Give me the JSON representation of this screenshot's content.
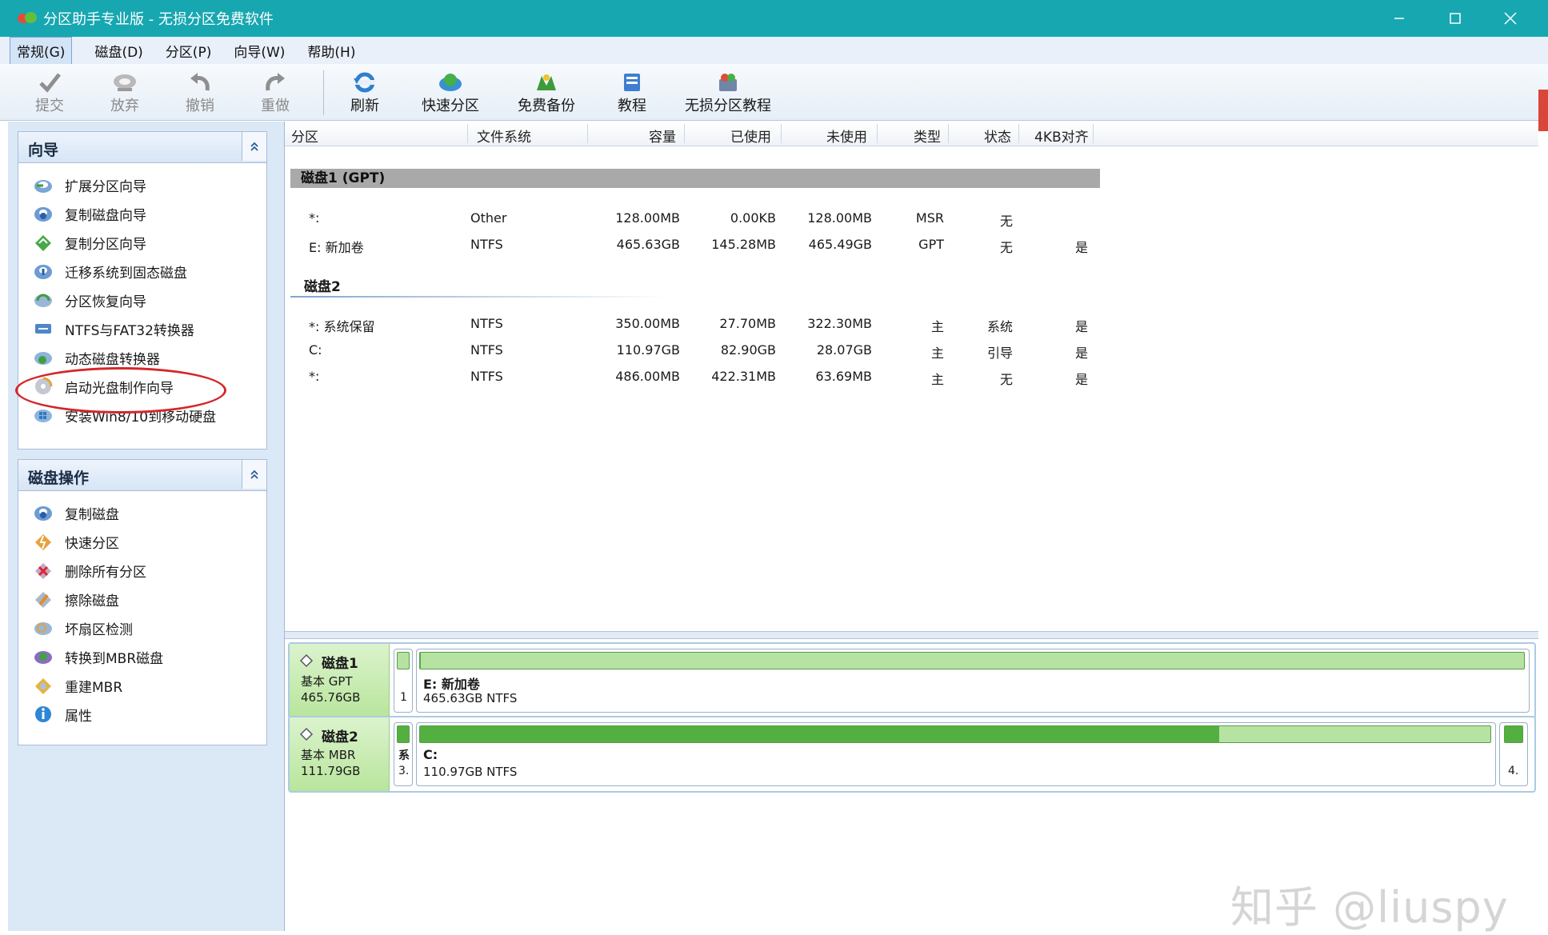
{
  "window": {
    "title": "分区助手专业版 - 无损分区免费软件",
    "controls": [
      "minimize",
      "maximize",
      "close"
    ]
  },
  "menu": [
    "常规(G)",
    "磁盘(D)",
    "分区(P)",
    "向导(W)",
    "帮助(H)"
  ],
  "toolbar": [
    {
      "label": "提交",
      "icon": "commit-check-icon",
      "enabled": false
    },
    {
      "label": "放弃",
      "icon": "discard-icon",
      "enabled": false
    },
    {
      "label": "撤销",
      "icon": "undo-icon",
      "enabled": false
    },
    {
      "label": "重做",
      "icon": "redo-icon",
      "enabled": false
    },
    {
      "label": "刷新",
      "icon": "refresh-icon",
      "enabled": true
    },
    {
      "label": "快速分区",
      "icon": "quick-partition-icon",
      "enabled": true
    },
    {
      "label": "免费备份",
      "icon": "free-backup-icon",
      "enabled": true
    },
    {
      "label": "教程",
      "icon": "tutorial-icon",
      "enabled": true
    },
    {
      "label": "无损分区教程",
      "icon": "lossless-tutorial-icon",
      "enabled": true
    }
  ],
  "wizard": {
    "title": "向导",
    "items": [
      "扩展分区向导",
      "复制磁盘向导",
      "复制分区向导",
      "迁移系统到固态磁盘",
      "分区恢复向导",
      "NTFS与FAT32转换器",
      "动态磁盘转换器",
      "启动光盘制作向导",
      "安装Win8/10到移动硬盘"
    ],
    "highlighted": "迁移系统到固态磁盘"
  },
  "disk_ops": {
    "title": "磁盘操作",
    "items": [
      "复制磁盘",
      "快速分区",
      "删除所有分区",
      "擦除磁盘",
      "坏扇区检测",
      "转换到MBR磁盘",
      "重建MBR",
      "属性"
    ]
  },
  "table": {
    "columns": [
      "分区",
      "文件系统",
      "容量",
      "已使用",
      "未使用",
      "类型",
      "状态",
      "4KB对齐"
    ],
    "disks": [
      {
        "name": "磁盘1 (GPT)",
        "rows": [
          [
            "*:",
            "Other",
            "128.00MB",
            "0.00KB",
            "128.00MB",
            "MSR",
            "无",
            ""
          ],
          [
            "E: 新加卷",
            "NTFS",
            "465.63GB",
            "145.28MB",
            "465.49GB",
            "GPT",
            "无",
            "是"
          ]
        ]
      },
      {
        "name": "磁盘2",
        "rows": [
          [
            "*: 系统保留",
            "NTFS",
            "350.00MB",
            "27.70MB",
            "322.30MB",
            "主",
            "系统",
            "是"
          ],
          [
            "C:",
            "NTFS",
            "110.97GB",
            "82.90GB",
            "28.07GB",
            "主",
            "引导",
            "是"
          ],
          [
            "*:",
            "NTFS",
            "486.00MB",
            "422.31MB",
            "63.69MB",
            "主",
            "无",
            "是"
          ]
        ]
      }
    ]
  },
  "diskmap": [
    {
      "name": "磁盘1",
      "type": "基本 GPT",
      "size": "465.76GB",
      "small_part": "1",
      "main_part": {
        "label": "E: 新加卷",
        "detail": "465.63GB NTFS",
        "used_fraction": 0.0003
      }
    },
    {
      "name": "磁盘2",
      "type": "基本 MBR",
      "size": "111.79GB",
      "small_part_a": "系",
      "small_part_b": "3.",
      "main_part": {
        "label": "C:",
        "detail": "110.97GB NTFS",
        "used_fraction": 0.747
      },
      "tail_part": "4."
    }
  ],
  "watermark": "知乎 @liuspy",
  "colors": {
    "titlebar": "#17a7b1",
    "highlight": "#d4272a",
    "used_bar": "#53b040",
    "free_bar": "#b6e2a2"
  }
}
